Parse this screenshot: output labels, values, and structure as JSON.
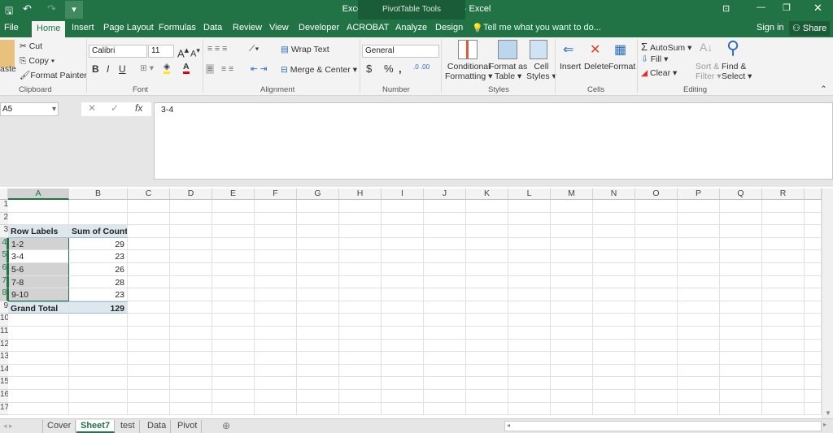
{
  "window": {
    "title": "Excel Histogram Exercise File - Excel",
    "context_tab": "PivotTable Tools",
    "qat_dropdown": "▾"
  },
  "menu_tabs": [
    "File",
    "Home",
    "Insert",
    "Page Layout",
    "Formulas",
    "Data",
    "Review",
    "View",
    "Developer",
    "ACROBAT",
    "Analyze",
    "Design"
  ],
  "tell_me": "Tell me what you want to do...",
  "sign_in": "Sign in",
  "share": "Share",
  "ribbon": {
    "clipboard": {
      "paste": "aste",
      "cut": "Cut",
      "copy": "Copy",
      "format_painter": "Format Painter",
      "label": "Clipboard"
    },
    "font": {
      "name": "Calibri",
      "size": "11",
      "bold": "B",
      "italic": "I",
      "underline": "U",
      "label": "Font"
    },
    "alignment": {
      "wrap": "Wrap Text",
      "merge": "Merge & Center",
      "label": "Alignment"
    },
    "number": {
      "format": "General",
      "currency": "$",
      "percent": "%",
      "comma": ",",
      "label": "Number"
    },
    "styles": {
      "conditional": "Conditional",
      "conditional2": "Formatting",
      "format_as": "Format as",
      "format_as2": "Table",
      "cell": "Cell",
      "cell2": "Styles",
      "label": "Styles"
    },
    "cells": {
      "insert": "Insert",
      "delete": "Delete",
      "format": "Format",
      "label": "Cells"
    },
    "editing": {
      "autosum": "AutoSum",
      "fill": "Fill",
      "clear": "Clear",
      "sort": "Sort &",
      "sort2": "Filter",
      "find": "Find &",
      "find2": "Select",
      "label": "Editing"
    }
  },
  "name_box": "A5",
  "formula": "3-4",
  "columns": [
    "A",
    "B",
    "C",
    "D",
    "E",
    "F",
    "G",
    "H",
    "I",
    "J",
    "K",
    "L",
    "M",
    "N",
    "O",
    "P",
    "Q",
    "R"
  ],
  "rows": [
    "1",
    "2",
    "3",
    "4",
    "5",
    "6",
    "7",
    "8",
    "9",
    "10",
    "11",
    "12",
    "13",
    "14",
    "15",
    "16",
    "17"
  ],
  "pivot": {
    "header": [
      "Row Labels",
      "Sum of Count"
    ],
    "items": [
      {
        "label": "1-2",
        "value": "29"
      },
      {
        "label": "3-4",
        "value": "23"
      },
      {
        "label": "5-6",
        "value": "26"
      },
      {
        "label": "7-8",
        "value": "28"
      },
      {
        "label": "9-10",
        "value": "23"
      }
    ],
    "total": {
      "label": "Grand Total",
      "value": "129"
    }
  },
  "sheets": [
    "Cover",
    "Sheet7",
    "test",
    "Data",
    "Pivot"
  ],
  "active_sheet": "Sheet7",
  "colors": {
    "brand": "#217346"
  }
}
